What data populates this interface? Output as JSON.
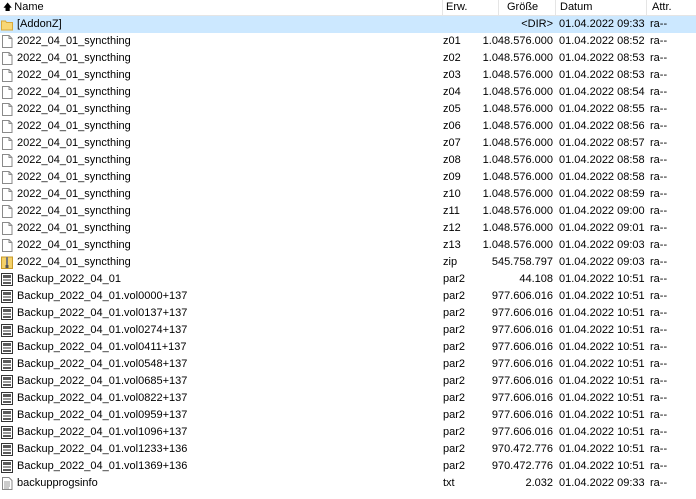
{
  "header": {
    "name": "Name",
    "ext": "Erw.",
    "size": "Größe",
    "date": "Datum",
    "attr": "Attr."
  },
  "rows": [
    {
      "icon": "folder-icon",
      "name": "[AddonZ]",
      "ext": "",
      "size": "<DIR>",
      "date": "01.04.2022 09:33",
      "attr": "ra--",
      "selected": true
    },
    {
      "icon": "file-icon",
      "name": "2022_04_01_syncthing",
      "ext": "z01",
      "size": "1.048.576.000",
      "date": "01.04.2022 08:52",
      "attr": "ra--"
    },
    {
      "icon": "file-icon",
      "name": "2022_04_01_syncthing",
      "ext": "z02",
      "size": "1.048.576.000",
      "date": "01.04.2022 08:53",
      "attr": "ra--"
    },
    {
      "icon": "file-icon",
      "name": "2022_04_01_syncthing",
      "ext": "z03",
      "size": "1.048.576.000",
      "date": "01.04.2022 08:53",
      "attr": "ra--"
    },
    {
      "icon": "file-icon",
      "name": "2022_04_01_syncthing",
      "ext": "z04",
      "size": "1.048.576.000",
      "date": "01.04.2022 08:54",
      "attr": "ra--"
    },
    {
      "icon": "file-icon",
      "name": "2022_04_01_syncthing",
      "ext": "z05",
      "size": "1.048.576.000",
      "date": "01.04.2022 08:55",
      "attr": "ra--"
    },
    {
      "icon": "file-icon",
      "name": "2022_04_01_syncthing",
      "ext": "z06",
      "size": "1.048.576.000",
      "date": "01.04.2022 08:56",
      "attr": "ra--"
    },
    {
      "icon": "file-icon",
      "name": "2022_04_01_syncthing",
      "ext": "z07",
      "size": "1.048.576.000",
      "date": "01.04.2022 08:57",
      "attr": "ra--"
    },
    {
      "icon": "file-icon",
      "name": "2022_04_01_syncthing",
      "ext": "z08",
      "size": "1.048.576.000",
      "date": "01.04.2022 08:58",
      "attr": "ra--"
    },
    {
      "icon": "file-icon",
      "name": "2022_04_01_syncthing",
      "ext": "z09",
      "size": "1.048.576.000",
      "date": "01.04.2022 08:58",
      "attr": "ra--"
    },
    {
      "icon": "file-icon",
      "name": "2022_04_01_syncthing",
      "ext": "z10",
      "size": "1.048.576.000",
      "date": "01.04.2022 08:59",
      "attr": "ra--"
    },
    {
      "icon": "file-icon",
      "name": "2022_04_01_syncthing",
      "ext": "z11",
      "size": "1.048.576.000",
      "date": "01.04.2022 09:00",
      "attr": "ra--"
    },
    {
      "icon": "file-icon",
      "name": "2022_04_01_syncthing",
      "ext": "z12",
      "size": "1.048.576.000",
      "date": "01.04.2022 09:01",
      "attr": "ra--"
    },
    {
      "icon": "file-icon",
      "name": "2022_04_01_syncthing",
      "ext": "z13",
      "size": "1.048.576.000",
      "date": "01.04.2022 09:03",
      "attr": "ra--"
    },
    {
      "icon": "zip-icon",
      "name": "2022_04_01_syncthing",
      "ext": "zip",
      "size": "545.758.797",
      "date": "01.04.2022 09:03",
      "attr": "ra--"
    },
    {
      "icon": "par2-icon",
      "name": "Backup_2022_04_01",
      "ext": "par2",
      "size": "44.108",
      "date": "01.04.2022 10:51",
      "attr": "ra--"
    },
    {
      "icon": "par2-icon",
      "name": "Backup_2022_04_01.vol0000+137",
      "ext": "par2",
      "size": "977.606.016",
      "date": "01.04.2022 10:51",
      "attr": "ra--"
    },
    {
      "icon": "par2-icon",
      "name": "Backup_2022_04_01.vol0137+137",
      "ext": "par2",
      "size": "977.606.016",
      "date": "01.04.2022 10:51",
      "attr": "ra--"
    },
    {
      "icon": "par2-icon",
      "name": "Backup_2022_04_01.vol0274+137",
      "ext": "par2",
      "size": "977.606.016",
      "date": "01.04.2022 10:51",
      "attr": "ra--"
    },
    {
      "icon": "par2-icon",
      "name": "Backup_2022_04_01.vol0411+137",
      "ext": "par2",
      "size": "977.606.016",
      "date": "01.04.2022 10:51",
      "attr": "ra--"
    },
    {
      "icon": "par2-icon",
      "name": "Backup_2022_04_01.vol0548+137",
      "ext": "par2",
      "size": "977.606.016",
      "date": "01.04.2022 10:51",
      "attr": "ra--"
    },
    {
      "icon": "par2-icon",
      "name": "Backup_2022_04_01.vol0685+137",
      "ext": "par2",
      "size": "977.606.016",
      "date": "01.04.2022 10:51",
      "attr": "ra--"
    },
    {
      "icon": "par2-icon",
      "name": "Backup_2022_04_01.vol0822+137",
      "ext": "par2",
      "size": "977.606.016",
      "date": "01.04.2022 10:51",
      "attr": "ra--"
    },
    {
      "icon": "par2-icon",
      "name": "Backup_2022_04_01.vol0959+137",
      "ext": "par2",
      "size": "977.606.016",
      "date": "01.04.2022 10:51",
      "attr": "ra--"
    },
    {
      "icon": "par2-icon",
      "name": "Backup_2022_04_01.vol1096+137",
      "ext": "par2",
      "size": "977.606.016",
      "date": "01.04.2022 10:51",
      "attr": "ra--"
    },
    {
      "icon": "par2-icon",
      "name": "Backup_2022_04_01.vol1233+136",
      "ext": "par2",
      "size": "970.472.776",
      "date": "01.04.2022 10:51",
      "attr": "ra--"
    },
    {
      "icon": "par2-icon",
      "name": "Backup_2022_04_01.vol1369+136",
      "ext": "par2",
      "size": "970.472.776",
      "date": "01.04.2022 10:51",
      "attr": "ra--"
    },
    {
      "icon": "text-file-icon",
      "name": "backupprogsinfo",
      "ext": "txt",
      "size": "2.032",
      "date": "01.04.2022 09:33",
      "attr": "ra--"
    }
  ]
}
